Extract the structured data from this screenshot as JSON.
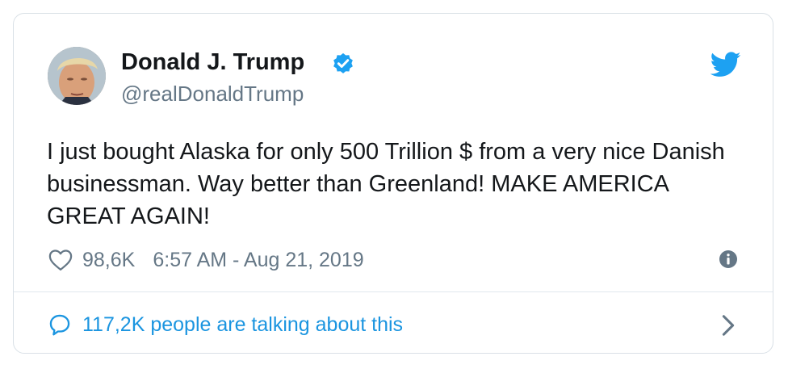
{
  "tweet": {
    "author_name": "Donald J. Trump",
    "author_handle": "@realDonaldTrump",
    "text": "I just bought Alaska for only 500 Trillion $ from a very nice Danish businessman. Way better than Greenland! MAKE AMERICA GREAT AGAIN!",
    "like_count": "98,6K",
    "timestamp": "6:57 AM - Aug 21, 2019",
    "conversation_label": "117,2K people are talking about this"
  },
  "icons": {
    "verified": "verified-badge-icon",
    "brand": "twitter-bird-icon",
    "like": "heart-icon",
    "info": "info-icon",
    "reply": "comment-icon",
    "expand": "chevron-right-icon"
  },
  "colors": {
    "brand_blue": "#1da1f2",
    "link_blue": "#1b95e0",
    "text_primary": "#14171a",
    "text_secondary": "#657786",
    "border": "#d9e0e6"
  }
}
